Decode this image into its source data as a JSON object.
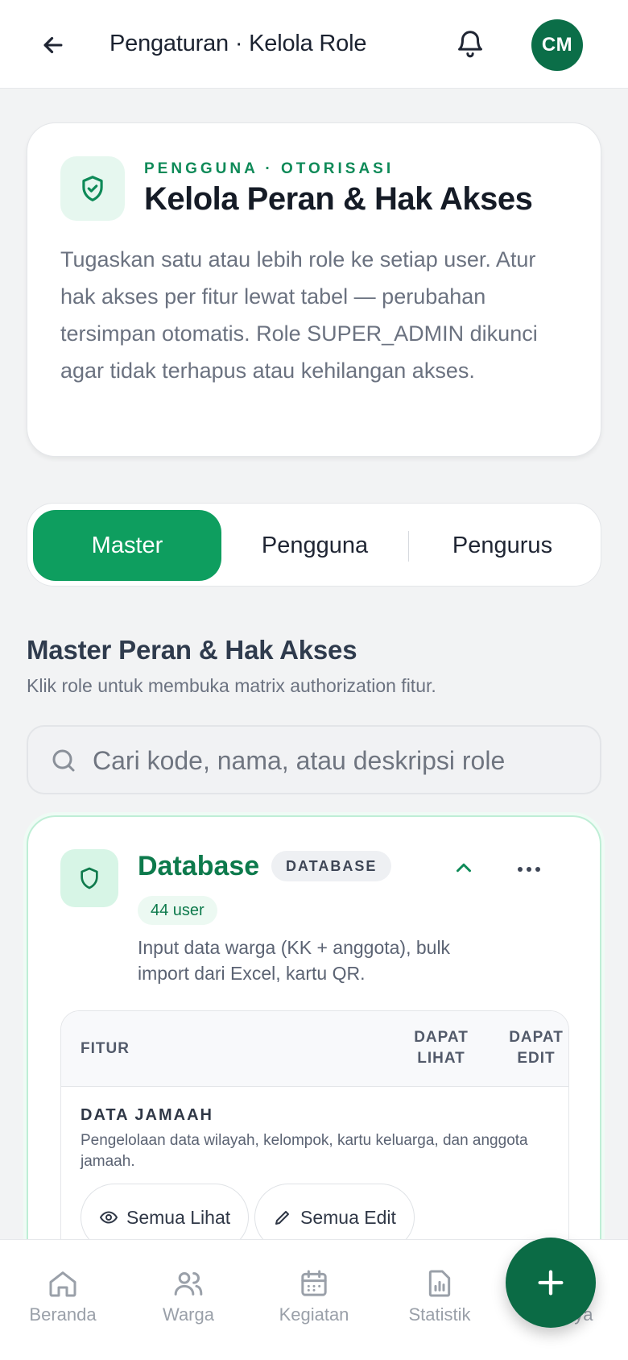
{
  "header": {
    "title": "Pengaturan · Kelola Role",
    "avatar_initials": "CM"
  },
  "intro": {
    "eyebrow": "PENGGUNA · OTORISASI",
    "heading": "Kelola Peran & Hak Akses",
    "description": "Tugaskan satu atau lebih role ke setiap user. Atur hak akses per fitur lewat tabel — perubahan tersimpan otomatis. Role SUPER_ADMIN dikunci agar tidak terhapus atau kehilangan akses."
  },
  "tabs": [
    {
      "label": "Master",
      "active": true
    },
    {
      "label": "Pengguna",
      "active": false
    },
    {
      "label": "Pengurus",
      "active": false
    }
  ],
  "section": {
    "title": "Master Peran & Hak Akses",
    "subtitle": "Klik role untuk membuka matrix authorization fitur."
  },
  "search": {
    "placeholder": "Cari kode, nama, atau deskripsi role"
  },
  "role_card": {
    "name": "Database",
    "code": "DATABASE",
    "user_count": "44 user",
    "description": "Input data warga (KK + anggota), bulk import dari Excel, kartu QR.",
    "table": {
      "col_fitur": "FITUR",
      "col_lihat": "DAPAT LIHAT",
      "col_edit": "DAPAT EDIT"
    },
    "group": {
      "title": "DATA JAMAAH",
      "description": "Pengelolaan data wilayah, kelompok, kartu keluarga, dan anggota jamaah.",
      "view_all_label": "Semua Lihat",
      "edit_all_label": "Semua Edit"
    }
  },
  "bottom_nav": [
    {
      "label": "Beranda",
      "icon": "home-icon"
    },
    {
      "label": "Warga",
      "icon": "users-icon"
    },
    {
      "label": "Kegiatan",
      "icon": "calendar-icon"
    },
    {
      "label": "Statistik",
      "icon": "chart-icon"
    },
    {
      "label": "Lainnya",
      "icon": "more-icon"
    }
  ],
  "colors": {
    "primary": "#0e9e5f",
    "primary_dark": "#0b6b45",
    "accent_text": "#0d7a4c"
  }
}
